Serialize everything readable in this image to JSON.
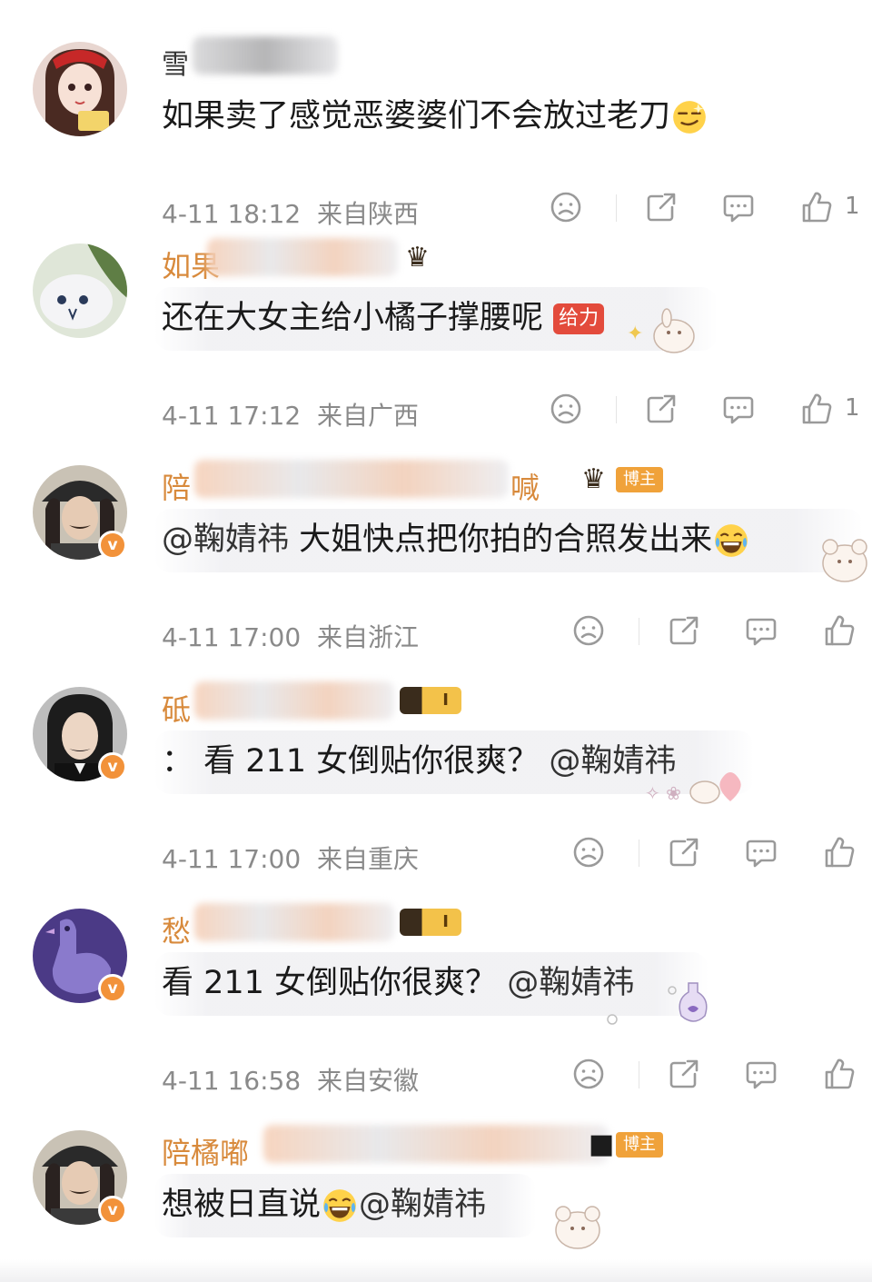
{
  "comments": [
    {
      "name_visible": "雪",
      "name_style": "gray",
      "text": "如果卖了感觉恶婆婆们不会放过老刀",
      "emoji": "smirk-emoji",
      "time": "4-11 18:12",
      "location": "来自陕西",
      "likes": "1",
      "verified": false
    },
    {
      "name_visible": "如果",
      "text": "还在大女主给小橘子撑腰呢",
      "badge_text": "给力",
      "time": "4-11 17:12",
      "location": "来自广西",
      "likes": "1",
      "verified": false
    },
    {
      "name_visible": "陪",
      "name_tail": "喊",
      "tag": "博主",
      "mention": "@鞠婧祎",
      "text": " 大姐快点把你拍的合照发出来",
      "emoji": "laugh-cry-emoji",
      "time": "4-11 17:00",
      "location": "来自浙江",
      "likes": "",
      "verified": true,
      "verified_label": "v"
    },
    {
      "name_visible": "砥",
      "level": "I",
      "text": "： 看 211 女倒贴你很爽？ ",
      "mention": "@鞠婧祎",
      "time": "4-11 17:00",
      "location": "来自重庆",
      "likes": "",
      "verified": true,
      "verified_label": "v"
    },
    {
      "name_visible": "愁",
      "level": "I",
      "text": "看 211 女倒贴你很爽？ ",
      "mention": "@鞠婧祎",
      "time": "4-11 16:58",
      "location": "来自安徽",
      "likes": "",
      "verified": true,
      "verified_label": "v"
    },
    {
      "name_visible": "陪橘嘟",
      "tag": "博主",
      "text": "想被日直说",
      "emoji": "laugh-cry-emoji",
      "mention": "@鞠婧祎",
      "verified": true,
      "verified_label": "v"
    }
  ]
}
